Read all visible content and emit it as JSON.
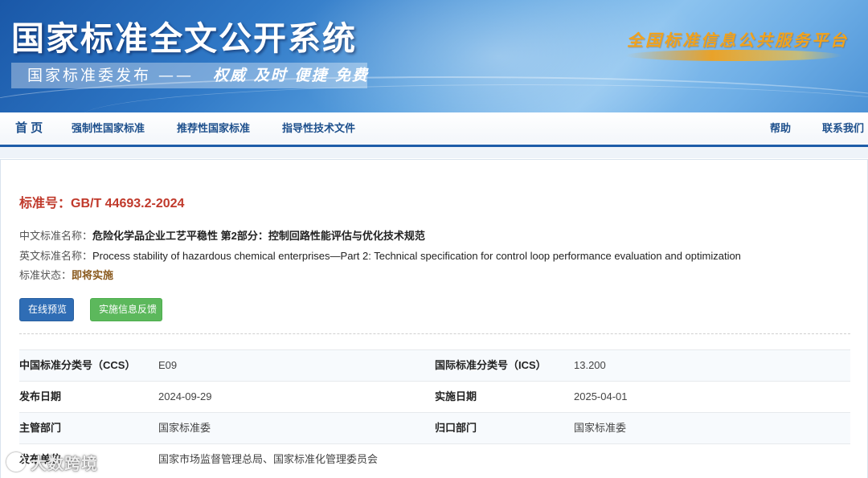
{
  "header": {
    "site_title": "国家标准全文公开系统",
    "subtitle_left": "国家标准委发布 ——",
    "subtitle_right": "权威 及时 便捷 免费",
    "platform_slogan": "全国标准信息公共服务平台"
  },
  "nav": {
    "items": [
      {
        "label": "首 页"
      },
      {
        "label": "强制性国家标准"
      },
      {
        "label": "推荐性国家标准"
      },
      {
        "label": "指导性技术文件"
      },
      {
        "label": "帮助"
      },
      {
        "label": "联系我们"
      }
    ]
  },
  "standard": {
    "title_label": "标准号：",
    "number": "GB/T 44693.2-2024",
    "cn_name_label": "中文标准名称：",
    "cn_name": "危险化学品企业工艺平稳性 第2部分：控制回路性能评估与优化技术规范",
    "en_name_label": "英文标准名称：",
    "en_name": "Process stability of hazardous chemical enterprises—Part 2: Technical specification for control loop performance evaluation and optimization",
    "status_label": "标准状态：",
    "status": "即将实施",
    "status_color": "#8a5a1e"
  },
  "buttons": {
    "preview": "在线预览",
    "feedback": "实施信息反馈"
  },
  "details": [
    {
      "k1": "中国标准分类号（CCS）",
      "v1": "E09",
      "k2": "国际标准分类号（ICS）",
      "v2": "13.200"
    },
    {
      "k1": "发布日期",
      "v1": "2024-09-29",
      "k2": "实施日期",
      "v2": "2025-04-01"
    },
    {
      "k1": "主管部门",
      "v1": "国家标准委",
      "k2": "归口部门",
      "v2": "国家标准委"
    },
    {
      "k1": "发布单位",
      "v1": "国家市场监督管理总局、国家标准化管理委员会",
      "k2": "",
      "v2": ""
    }
  ],
  "watermark": "大数跨境",
  "colors": {
    "brand_blue": "#1d5ca8",
    "title_red": "#c0392b",
    "button_blue": "#2f6db5",
    "button_green": "#5cb85c"
  }
}
